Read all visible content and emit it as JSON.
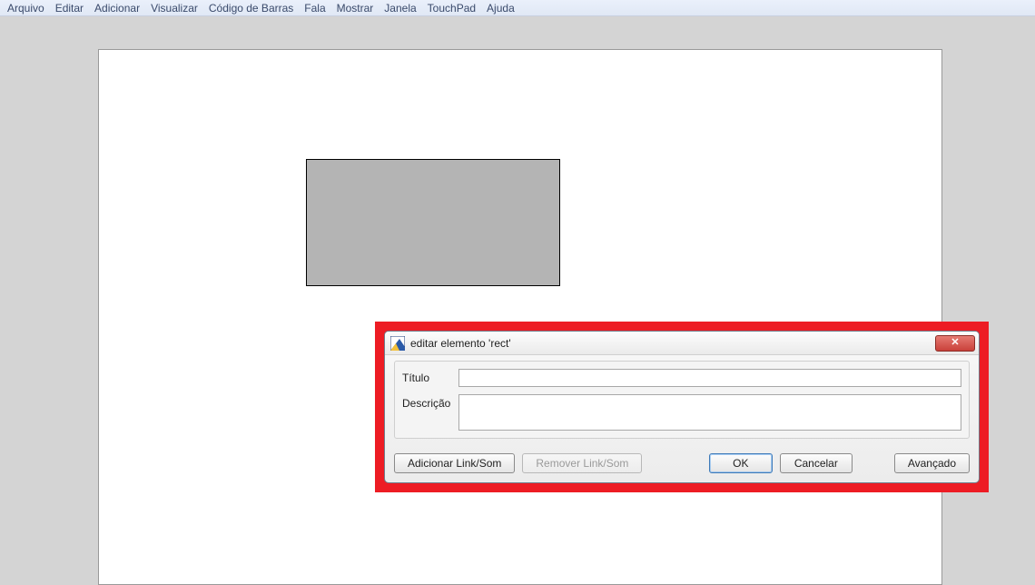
{
  "menu": {
    "items": [
      "Arquivo",
      "Editar",
      "Adicionar",
      "Visualizar",
      "Código de Barras",
      "Fala",
      "Mostrar",
      "Janela",
      "TouchPad",
      "Ajuda"
    ]
  },
  "dialog": {
    "title": "editar elemento 'rect'",
    "fields": {
      "title_label": "Título",
      "title_value": "",
      "desc_label": "Descrição",
      "desc_value": ""
    },
    "buttons": {
      "add_link": "Adicionar Link/Som",
      "remove_link": "Remover Link/Som",
      "ok": "OK",
      "cancel": "Cancelar",
      "advanced": "Avançado"
    },
    "close_glyph": "✕"
  }
}
